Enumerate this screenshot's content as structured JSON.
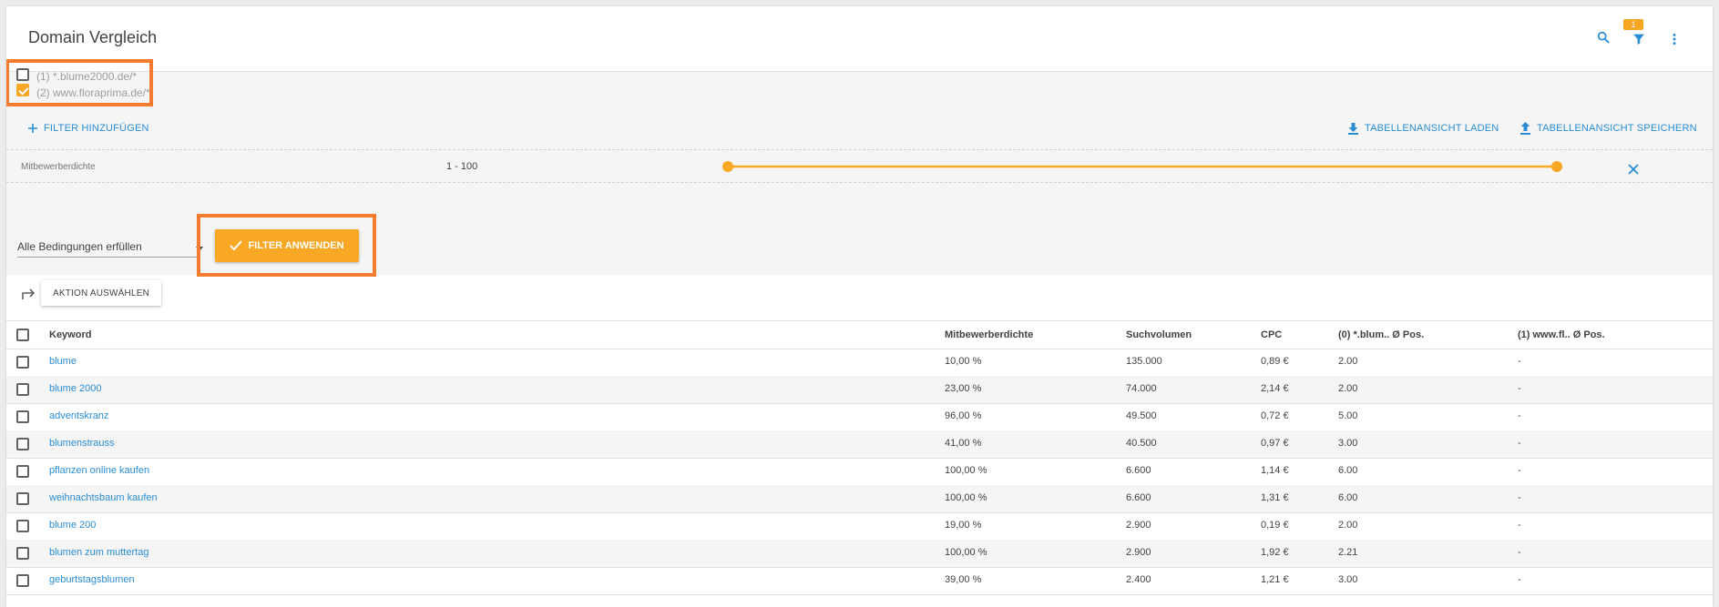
{
  "header": {
    "title": "Domain Vergleich",
    "filter_badge": "1"
  },
  "domains": [
    {
      "label": "(1) *.blume2000.de/*",
      "checked": false
    },
    {
      "label": "(2) www.floraprima.de/*",
      "checked": true
    }
  ],
  "toolbar": {
    "add_filter": "FILTER HINZUFÜGEN",
    "load_view": "TABELLENANSICHT LADEN",
    "save_view": "TABELLENANSICHT SPEICHERN"
  },
  "filter_row": {
    "name": "Mitbewerberdichte",
    "range_text": "1 - 100",
    "range_min_fraction": 0.0,
    "range_max_fraction": 1.0
  },
  "conditions": {
    "selected": "Alle Bedingungen erfüllen",
    "apply_label": "FILTER ANWENDEN"
  },
  "action": {
    "label": "AKTION AUSWÄHLEN"
  },
  "table": {
    "columns": [
      "Keyword",
      "Mitbewerberdichte",
      "Suchvolumen",
      "CPC",
      "(0) *.blum.. Ø Pos.",
      "(1) www.fl.. Ø Pos."
    ],
    "rows": [
      [
        "blume",
        "10,00 %",
        "135.000",
        "0,89 €",
        "2.00",
        "-"
      ],
      [
        "blume 2000",
        "23,00 %",
        "74.000",
        "2,14 €",
        "2.00",
        "-"
      ],
      [
        "adventskranz",
        "96,00 %",
        "49.500",
        "0,72 €",
        "5.00",
        "-"
      ],
      [
        "blumenstrauss",
        "41,00 %",
        "40.500",
        "0,97 €",
        "3.00",
        "-"
      ],
      [
        "pflanzen online kaufen",
        "100,00 %",
        "6.600",
        "1,14 €",
        "6.00",
        "-"
      ],
      [
        "weihnachtsbaum kaufen",
        "100,00 %",
        "6.600",
        "1,31 €",
        "6.00",
        "-"
      ],
      [
        "blume 200",
        "19,00 %",
        "2.900",
        "0,19 €",
        "2.00",
        "-"
      ],
      [
        "blumen zum muttertag",
        "100,00 %",
        "2.900",
        "1,92 €",
        "2.21",
        "-"
      ],
      [
        "geburtstagsblumen",
        "39,00 %",
        "2.400",
        "1,21 €",
        "3.00",
        "-"
      ]
    ]
  },
  "colors": {
    "accent": "#f9a825",
    "link": "#2a8dd4",
    "highlight": "#f57c2c"
  }
}
